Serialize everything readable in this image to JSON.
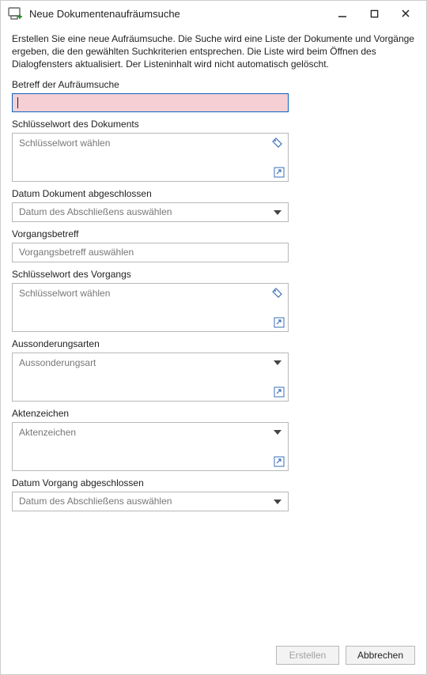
{
  "window": {
    "title": "Neue Dokumentenaufräumsuche"
  },
  "description": "Erstellen Sie eine neue Aufräumsuche. Die Suche wird eine Liste der Dokumente und Vorgänge ergeben, die den gewählten Suchkriterien entsprechen. Die Liste wird beim Öffnen des Dialogfensters aktualisiert. Der Listeninhalt wird nicht automatisch gelöscht.",
  "fields": {
    "subject": {
      "label": "Betreff der Aufräumsuche",
      "value": ""
    },
    "doc_keyword": {
      "label": "Schlüsselwort des Dokuments",
      "placeholder": "Schlüsselwort wählen"
    },
    "doc_closed_date": {
      "label": "Datum Dokument abgeschlossen",
      "placeholder": "Datum des Abschließens auswählen"
    },
    "case_subject": {
      "label": "Vorgangsbetreff",
      "placeholder": "Vorgangsbetreff auswählen"
    },
    "case_keyword": {
      "label": "Schlüsselwort des Vorgangs",
      "placeholder": "Schlüsselwort wählen"
    },
    "disposal_types": {
      "label": "Aussonderungsarten",
      "placeholder": "Aussonderungsart"
    },
    "file_ref": {
      "label": "Aktenzeichen",
      "placeholder": "Aktenzeichen"
    },
    "case_closed_date": {
      "label": "Datum Vorgang abgeschlossen",
      "placeholder": "Datum des Abschließens auswählen"
    }
  },
  "buttons": {
    "create": "Erstellen",
    "cancel": "Abbrechen"
  }
}
